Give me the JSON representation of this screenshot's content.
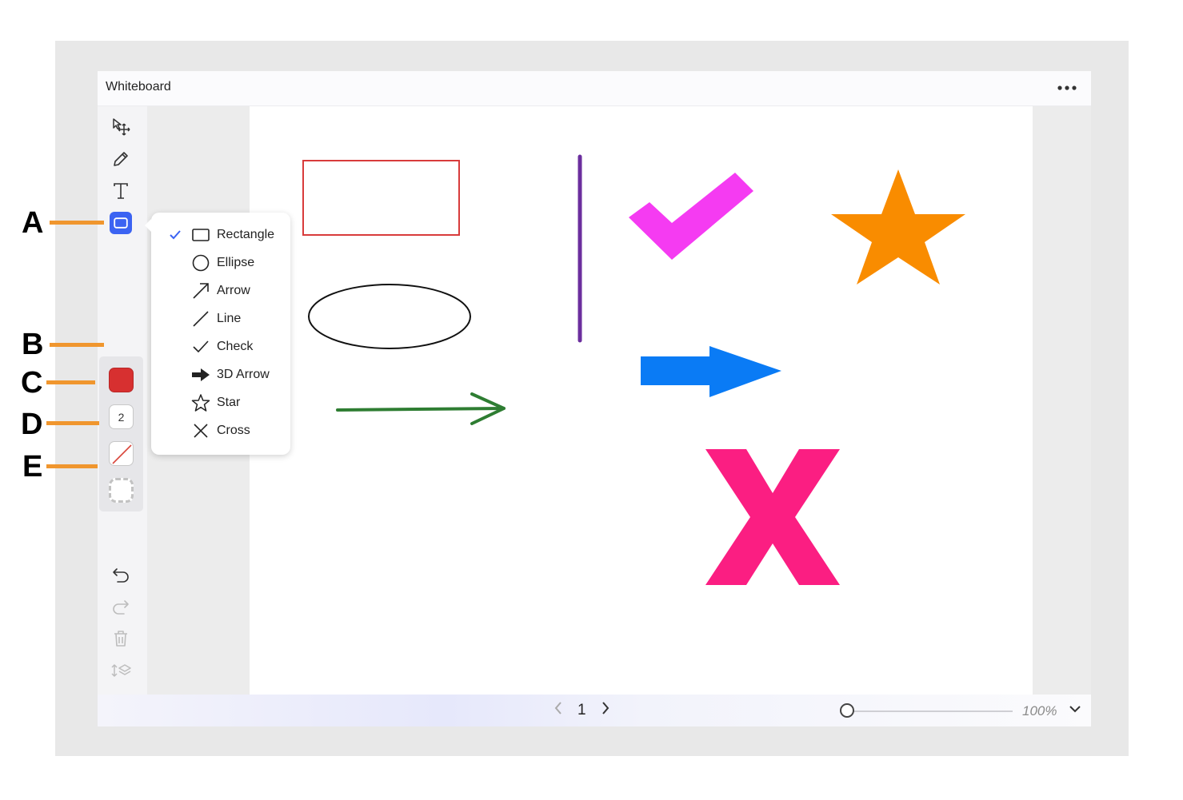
{
  "app": {
    "title": "Whiteboard",
    "more_icon": "more-horizontal-icon"
  },
  "toolbar": {
    "tools": [
      {
        "name": "select-move-icon"
      },
      {
        "name": "pencil-icon"
      },
      {
        "name": "text-icon"
      },
      {
        "name": "shape-rectangle-icon",
        "active": true
      }
    ],
    "bottom_tools": [
      {
        "name": "undo-icon",
        "enabled": true
      },
      {
        "name": "redo-icon",
        "enabled": false
      },
      {
        "name": "trash-icon",
        "enabled": false
      },
      {
        "name": "arrange-layers-icon",
        "enabled": false
      }
    ],
    "fill_color": "#d73030",
    "stroke_width": "2",
    "accent_color": "#3b63f2"
  },
  "shape_menu": {
    "items": [
      {
        "label": "Rectangle",
        "icon": "rectangle-icon",
        "selected": true
      },
      {
        "label": "Ellipse",
        "icon": "ellipse-icon",
        "selected": false
      },
      {
        "label": "Arrow",
        "icon": "arrow-icon",
        "selected": false
      },
      {
        "label": "Line",
        "icon": "line-icon",
        "selected": false
      },
      {
        "label": "Check",
        "icon": "check-icon",
        "selected": false
      },
      {
        "label": "3D Arrow",
        "icon": "3d-arrow-icon",
        "selected": false
      },
      {
        "label": "Star",
        "icon": "star-icon",
        "selected": false
      },
      {
        "label": "Cross",
        "icon": "cross-icon",
        "selected": false
      }
    ]
  },
  "canvas_shapes": {
    "rectangle_color": "#d83b3b",
    "ellipse_color": "#111111",
    "arrow_color": "#2e7d32",
    "line_color": "#6b2e9e",
    "check_color": "#f53bf2",
    "star_color": "#f98c00",
    "arrow3d_color": "#0a7bf5",
    "cross_color": "#fb1e82"
  },
  "pager": {
    "page": "1"
  },
  "zoom": {
    "label": "100%",
    "level": 0
  },
  "callouts": [
    "A",
    "B",
    "C",
    "D",
    "E"
  ]
}
